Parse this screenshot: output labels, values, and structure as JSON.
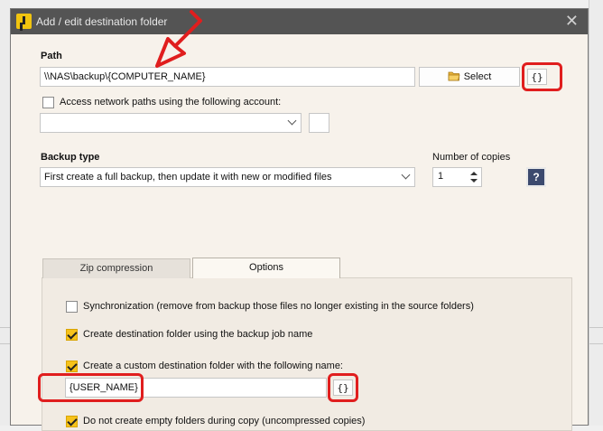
{
  "window": {
    "title": "Add / edit destination folder",
    "close_glyph": "✕"
  },
  "path": {
    "label": "Path",
    "value": "\\\\NAS\\backup\\{COMPUTER_NAME}",
    "select_label": "Select",
    "variables_label": "{}"
  },
  "network": {
    "checkbox_label": "Access network paths using the following account:",
    "checked": false,
    "account_value": ""
  },
  "backup_type": {
    "label": "Backup type",
    "value": "First create a full backup, then update it with new or modified files",
    "copies_label": "Number of copies",
    "copies_value": "1",
    "help_label": "?"
  },
  "tabs": [
    {
      "label": "Zip compression",
      "active": false
    },
    {
      "label": "Options",
      "active": true
    }
  ],
  "options": {
    "sync_label": "Synchronization (remove from backup those files no longer existing in the source folders)",
    "sync_checked": false,
    "jobname_label": "Create destination folder using the backup job name",
    "jobname_checked": true,
    "custom_label": "Create a custom destination folder with the following name:",
    "custom_checked": true,
    "custom_value": "{USER_NAME}",
    "custom_variables_label": "{}",
    "empty_label": "Do not create empty folders during copy (uncompressed copies)",
    "empty_checked": true
  },
  "colors": {
    "accent": "#f6c21b",
    "annotation": "#e01e1e",
    "titlebar": "#545454"
  }
}
